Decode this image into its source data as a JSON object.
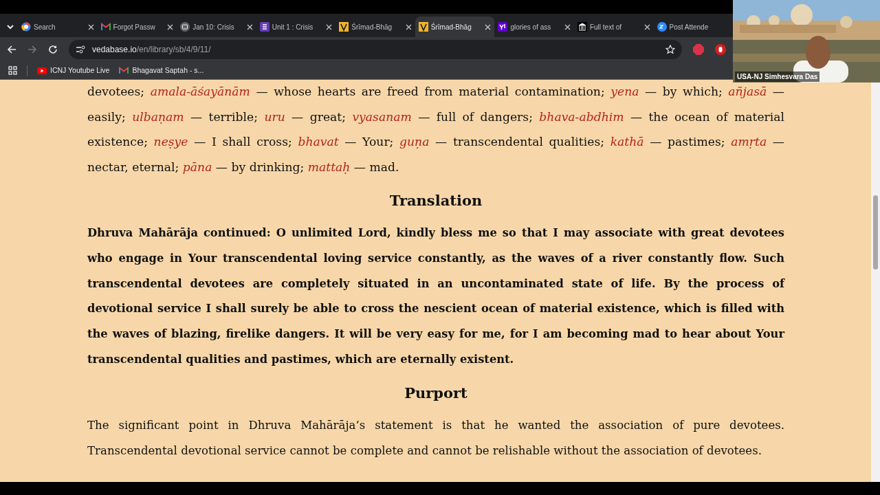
{
  "tabs": [
    {
      "title": "Search",
      "selected": false
    },
    {
      "title": "Forgot Passw",
      "selected": false
    },
    {
      "title": "Jan 10: Crisis",
      "selected": false
    },
    {
      "title": "Unit 1 : Crisis",
      "selected": false
    },
    {
      "title": "Śrīmad-Bhāg",
      "selected": false
    },
    {
      "title": "Śrīmad-Bhāg",
      "selected": true
    },
    {
      "title": "glories of ass",
      "selected": false
    },
    {
      "title": "Full text of",
      "selected": false
    },
    {
      "title": "Post Attende",
      "selected": false
    }
  ],
  "address": {
    "host": "vedabase.io",
    "path": "/en/library/sb/4/9/11/"
  },
  "bookmarks": [
    "ICNJ Youtube Live",
    "Bhagavat Saptah - s..."
  ],
  "video": {
    "participant": "USA-NJ Simhesvara Das"
  },
  "synonyms": "devotees; *amala-āśayānām* — whose hearts are freed from material contamination; *yena* — by which; *añjasā* — easily; *ulbaṇam* — terrible; *uru* — great; *vyasanam* — full of dangers; *bhava-abdhim* — the ocean of material existence; *neṣye* — I shall cross; *bhavat* — Your; *guṇa* — transcendental qualities; *kathā* — pastimes; *amṛta* — nectar, eternal; *pāna* — by drinking; *mattaḥ* — mad.",
  "translation": {
    "heading": "Translation",
    "text": "Dhruva Mahārāja continued: O unlimited Lord, kindly bless me so that I may associate with great devotees who engage in Your transcendental loving service constantly, as the waves of a river constantly flow. Such transcendental devotees are completely situated in an uncontaminated state of life. By the process of devotional service I shall surely be able to cross the nescient ocean of material existence, which is filled with the waves of blazing, firelike dangers. It will be very easy for me, for I am becoming mad to hear about Your transcendental qualities and pastimes, which are eternally existent."
  },
  "purport": {
    "heading": "Purport",
    "text": "The significant point in Dhruva Mahārāja’s statement is that he wanted the association of pure devotees. Transcendental devotional service cannot be complete and cannot be relishable without the association of devotees."
  }
}
